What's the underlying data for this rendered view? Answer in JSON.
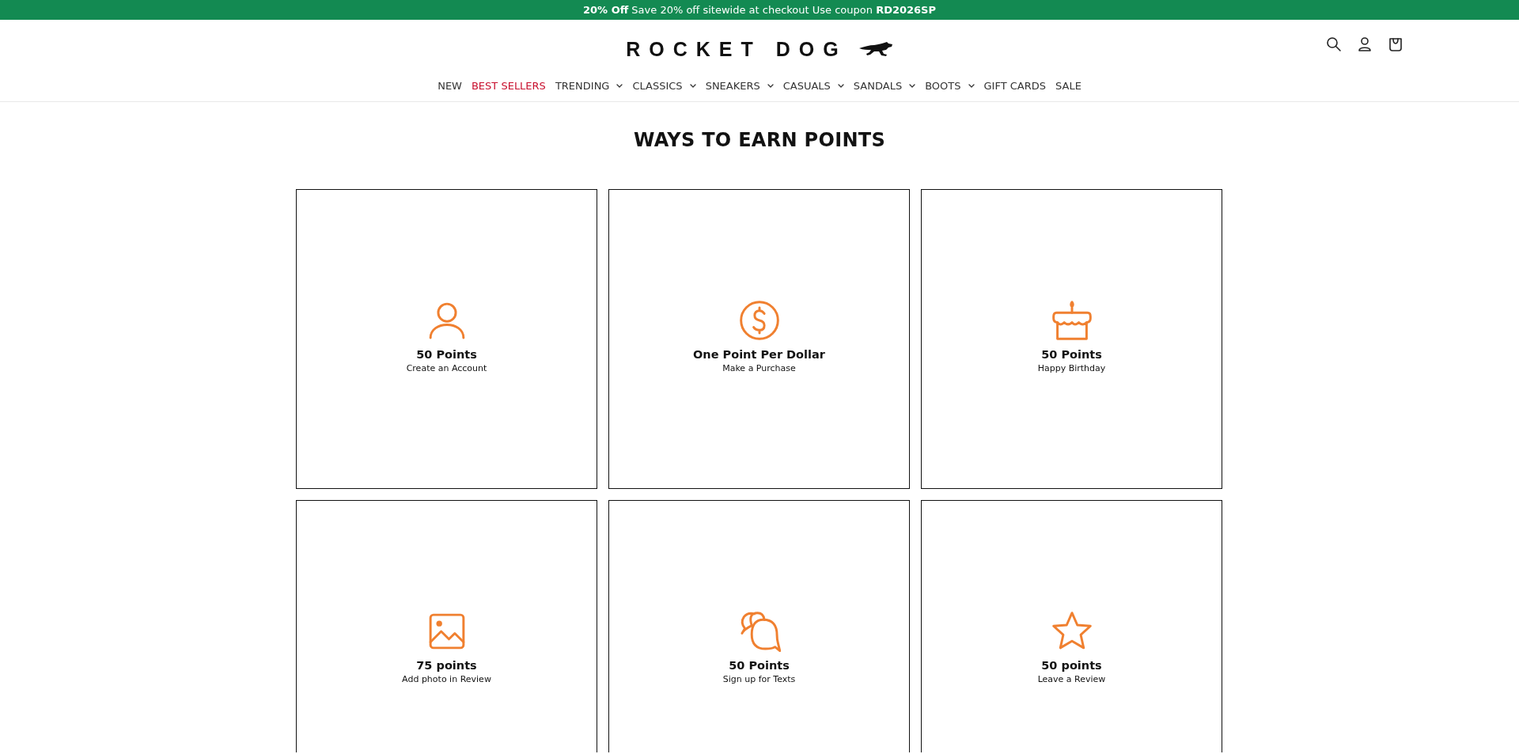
{
  "announcement": "**20% Off** Save 20% off sitewide at checkout Use coupon **RD2026SP**",
  "header": {
    "logo": "ROCKET DOG"
  },
  "nav": [
    {
      "label": "NEW",
      "dropdown": false,
      "color": "#333333"
    },
    {
      "label": "BEST SELLERS",
      "dropdown": false,
      "color": "#c8102e"
    },
    {
      "label": "TRENDING",
      "dropdown": true,
      "color": "#333333"
    },
    {
      "label": "CLASSICS",
      "dropdown": true,
      "color": "#333333"
    },
    {
      "label": "SNEAKERS",
      "dropdown": true,
      "color": "#333333"
    },
    {
      "label": "CASUALS",
      "dropdown": true,
      "color": "#333333"
    },
    {
      "label": "SANDALS",
      "dropdown": true,
      "color": "#333333"
    },
    {
      "label": "BOOTS",
      "dropdown": true,
      "color": "#333333"
    },
    {
      "label": "GIFT CARDS",
      "dropdown": false,
      "color": "#333333"
    },
    {
      "label": "SALE",
      "dropdown": false,
      "color": "#333333"
    }
  ],
  "heading": "WAYS TO EARN POINTS",
  "cards": [
    {
      "title": "50 Points",
      "subtitle": "Create an Account"
    },
    {
      "title": "One Point Per Dollar",
      "subtitle": "Make a Purchase"
    },
    {
      "title": "50 Points",
      "subtitle": "Happy Birthday"
    },
    {
      "title": "75 points",
      "subtitle": "Add photo in Review"
    },
    {
      "title": "50 Points",
      "subtitle": "Sign up for Texts"
    },
    {
      "title": "50 points",
      "subtitle": "Leave a Review"
    }
  ]
}
